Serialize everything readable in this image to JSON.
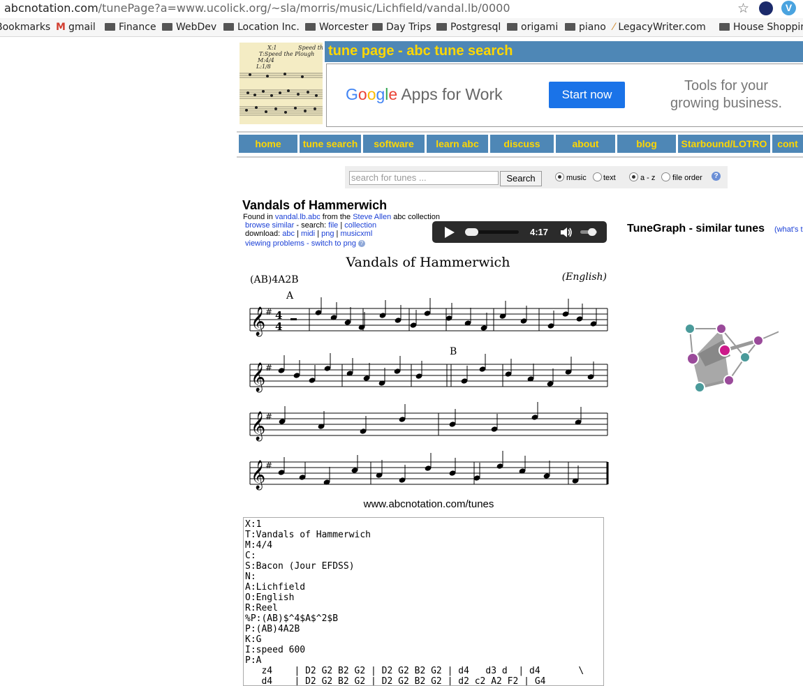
{
  "browser": {
    "url_host": "abcnotation.com",
    "url_path": "/tunePage?a=www.ucolick.org/~sla/morris/music/Lichfield/vandal.lb/0000",
    "extension_label": "V",
    "bookmarks": [
      "Bookmarks",
      "gmail",
      "Finance",
      "WebDev",
      "Location Inc.",
      "Worcester",
      "Day Trips",
      "Postgresql",
      "origami",
      "piano",
      "LegacyWriter.com",
      "House Shopping"
    ]
  },
  "header": {
    "title": "tune page - abc tune search",
    "logo_text": [
      "X:1",
      "T:Speed the Plough",
      "M:4/4",
      "L:1/8",
      "Speed the"
    ]
  },
  "ad": {
    "brand": "Google",
    "product": "Apps for Work",
    "cta": "Start now",
    "tagline_1": "Tools for your",
    "tagline_2": "growing business."
  },
  "nav": [
    "home",
    "tune search",
    "software",
    "learn abc",
    "discuss",
    "about",
    "blog",
    "Starbound/LOTRO",
    "cont"
  ],
  "search": {
    "placeholder": "search for tunes ...",
    "button": "Search",
    "opt_music": "music",
    "opt_text": "text",
    "opt_az": "a - z",
    "opt_fileorder": "file order",
    "help": "?"
  },
  "tune": {
    "title": "Vandals of Hammerwich",
    "found_in": "Found in",
    "file": "vandal.lb.abc",
    "from_the": "from the",
    "collection_name": "Steve Allen",
    "collection_suffix": "abc collection",
    "browse_similar": "browse similar",
    "search_label": "- search:",
    "search_file": "file",
    "search_collection": "collection",
    "download_label": "download:",
    "dl_abc": "abc",
    "dl_midi": "midi",
    "dl_png": "png",
    "dl_musicxml": "musicxml",
    "viewing_problems": "viewing problems - switch to png",
    "sep": "|"
  },
  "player": {
    "time": "4:17",
    "progress": 0.0
  },
  "tunegraph": {
    "title": "TuneGraph - similar tunes",
    "whats": "(what's t"
  },
  "score": {
    "title": "Vandals of Hammerwich",
    "parts": "(AB)4A2B",
    "origin": "(English)",
    "part_a": "A",
    "part_b": "B"
  },
  "footer_url": "www.abcnotation.com/tunes",
  "abc_text": "X:1\nT:Vandals of Hammerwich\nM:4/4\nC:\nS:Bacon (Jour EFDSS)\nN:\nA:Lichfield\nO:English\nR:Reel\n%P:(AB)$^4$A$^2$B\nP:(AB)4A2B\nK:G\nI:speed 600\nP:A\n   z4    | D2 G2 B2 G2 | D2 G2 B2 G2 | d4   d3 d  | d4       \\\n   d4    | D2 G2 B2 G2 | D2 G2 B2 G2 | d2 c2 A2 F2 | G4"
}
